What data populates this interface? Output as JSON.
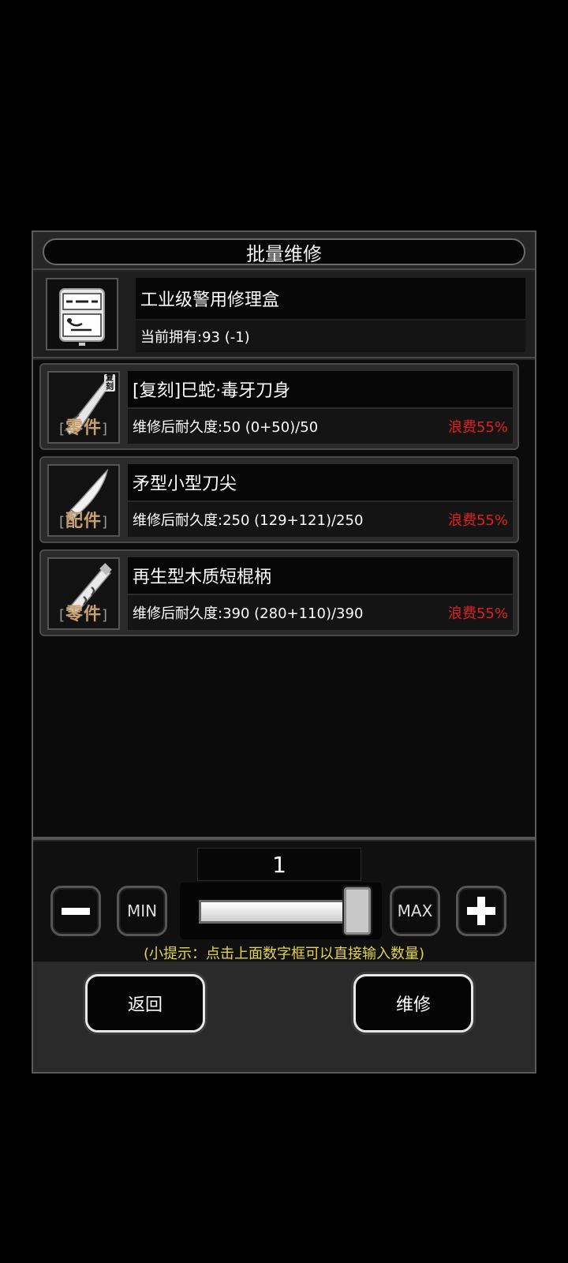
{
  "dialog": {
    "title": "批量维修"
  },
  "repair_kit": {
    "icon": "toolbox-icon",
    "name": "工业级警用修理盒",
    "owned": "当前拥有:93 (-1)"
  },
  "items": [
    {
      "icon": "blade-icon",
      "tag": "零件",
      "copy_badge": "复刻",
      "name": "[复刻]巳蛇·毒牙刀身",
      "durability": "维修后耐久度:50 (0+50)/50",
      "waste": "浪费55%"
    },
    {
      "icon": "knife-tip-icon",
      "tag": "配件",
      "name": "矛型小型刀尖",
      "durability": "维修后耐久度:250 (129+121)/250",
      "waste": "浪费55%"
    },
    {
      "icon": "handle-icon",
      "tag": "零件",
      "name": "再生型木质短棍柄",
      "durability": "维修后耐久度:390 (280+110)/390",
      "waste": "浪费55%"
    }
  ],
  "quantity": {
    "value": "1",
    "min_label": "MIN",
    "max_label": "MAX",
    "slider_fraction": 1.0,
    "hint": "(小提示：点击上面数字框可以直接输入数量)"
  },
  "buttons": {
    "back": "返回",
    "repair": "维修"
  },
  "colors": {
    "waste": "#e02020",
    "hint": "#e6d34a"
  }
}
